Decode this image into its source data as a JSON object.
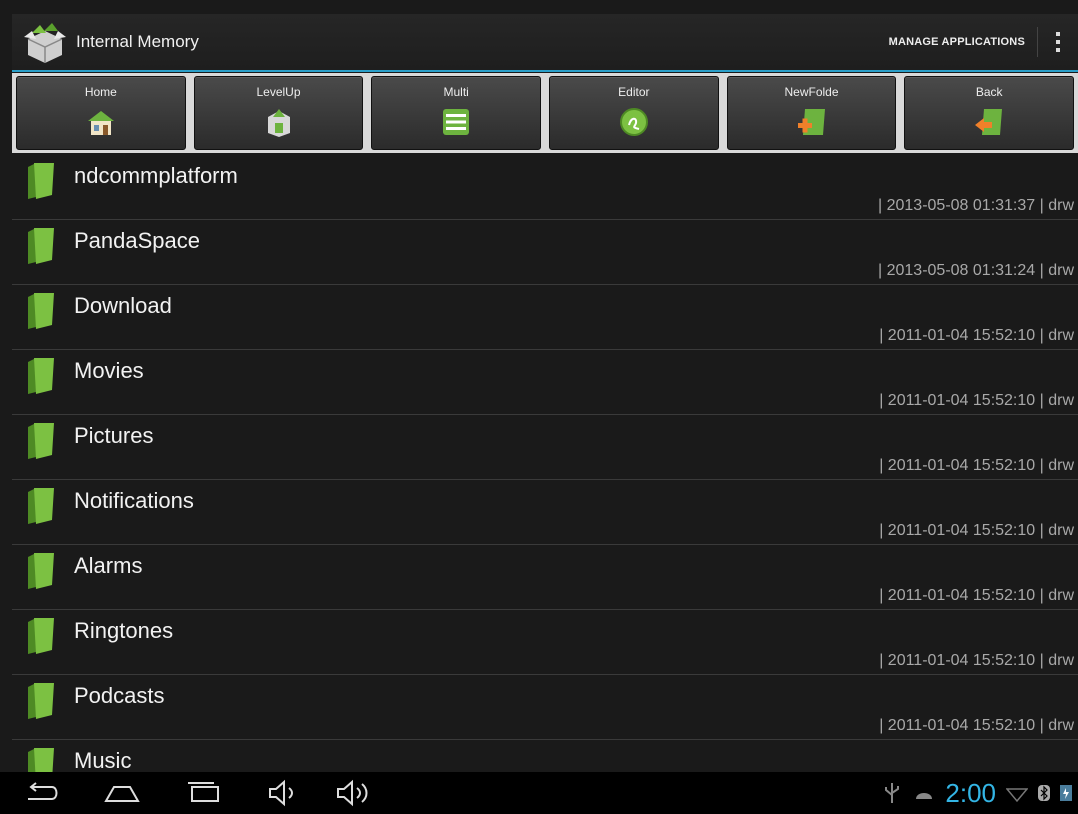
{
  "actionbar": {
    "title": "Internal Memory",
    "manage_label": "MANAGE APPLICATIONS"
  },
  "toolbar": [
    {
      "label": "Home",
      "icon": "home-icon"
    },
    {
      "label": "LevelUp",
      "icon": "level-up-icon"
    },
    {
      "label": "Multi",
      "icon": "multi-select-icon"
    },
    {
      "label": "Editor",
      "icon": "editor-icon"
    },
    {
      "label": "NewFolde",
      "icon": "new-folder-icon"
    },
    {
      "label": "Back",
      "icon": "back-icon"
    }
  ],
  "files": [
    {
      "name": "ndcommplatform",
      "meta": "| 2013-05-08 01:31:37 | drw"
    },
    {
      "name": "PandaSpace",
      "meta": "| 2013-05-08 01:31:24 | drw"
    },
    {
      "name": "Download",
      "meta": "| 2011-01-04 15:52:10 | drw"
    },
    {
      "name": "Movies",
      "meta": "| 2011-01-04 15:52:10 | drw"
    },
    {
      "name": "Pictures",
      "meta": "| 2011-01-04 15:52:10 | drw"
    },
    {
      "name": "Notifications",
      "meta": "| 2011-01-04 15:52:10 | drw"
    },
    {
      "name": "Alarms",
      "meta": "| 2011-01-04 15:52:10 | drw"
    },
    {
      "name": "Ringtones",
      "meta": "| 2011-01-04 15:52:10 | drw"
    },
    {
      "name": "Podcasts",
      "meta": "| 2011-01-04 15:52:10 | drw"
    },
    {
      "name": "Music",
      "meta": ""
    }
  ],
  "statusbar": {
    "time": "2:00"
  },
  "colors": {
    "accent": "#2a9fc9",
    "clock": "#33b5e5",
    "folder_green": "#6db33f"
  }
}
